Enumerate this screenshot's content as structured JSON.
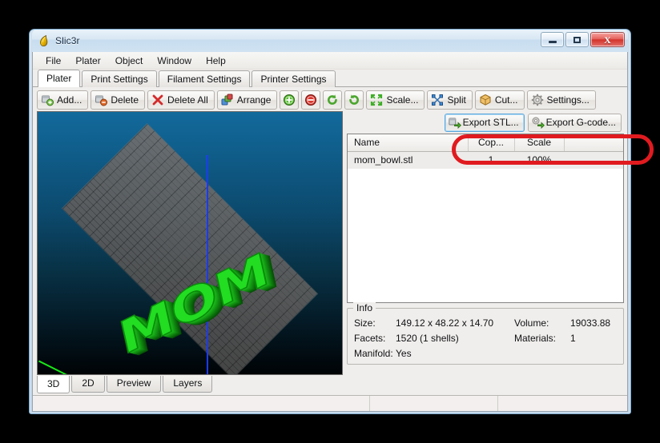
{
  "window": {
    "title": "Slic3r",
    "app_icon": "slic3r-logo-icon",
    "controls": {
      "minimize_label": "Minimize",
      "maximize_label": "Maximize",
      "close_label": "Close"
    }
  },
  "menubar": {
    "items": [
      "File",
      "Plater",
      "Object",
      "Window",
      "Help"
    ]
  },
  "tabs": [
    {
      "label": "Plater",
      "active": true
    },
    {
      "label": "Print Settings",
      "active": false
    },
    {
      "label": "Filament Settings",
      "active": false
    },
    {
      "label": "Printer Settings",
      "active": false
    }
  ],
  "toolbar": {
    "buttons": [
      {
        "label": "Add...",
        "icon": "add-object-icon",
        "icon_only": false
      },
      {
        "label": "Delete",
        "icon": "delete-object-icon",
        "icon_only": false
      },
      {
        "label": "Delete All",
        "icon": "delete-all-icon",
        "icon_only": false
      },
      {
        "label": "Arrange",
        "icon": "arrange-icon",
        "icon_only": false
      },
      {
        "label": "",
        "icon": "increase-copies-icon",
        "icon_only": true
      },
      {
        "label": "",
        "icon": "decrease-copies-icon",
        "icon_only": true
      },
      {
        "label": "",
        "icon": "rotate-ccw-icon",
        "icon_only": true
      },
      {
        "label": "",
        "icon": "rotate-cw-icon",
        "icon_only": true
      },
      {
        "label": "Scale...",
        "icon": "scale-icon",
        "icon_only": false
      },
      {
        "label": "Split",
        "icon": "split-icon",
        "icon_only": false
      },
      {
        "label": "Cut...",
        "icon": "cut-icon",
        "icon_only": false
      },
      {
        "label": "Settings...",
        "icon": "settings-gear-icon",
        "icon_only": false
      }
    ]
  },
  "export": {
    "stl_label": "Export STL...",
    "gcode_label": "Export G-code...",
    "stl_icon": "export-stl-icon",
    "gcode_icon": "export-gcode-icon",
    "highlight_color": "#e01b20"
  },
  "plater": {
    "model_text": "MOM",
    "bed_color": "#5f5f5f",
    "object_color": "#22dd22",
    "axis_x_color": "#ff1d1d",
    "axis_y_color": "#19e519",
    "axis_z_color": "#1b3bff",
    "view_tabs": [
      {
        "label": "3D",
        "active": true
      },
      {
        "label": "2D",
        "active": false
      },
      {
        "label": "Preview",
        "active": false
      },
      {
        "label": "Layers",
        "active": false
      }
    ]
  },
  "object_list": {
    "columns": [
      "Name",
      "Cop...",
      "Scale",
      ""
    ],
    "rows": [
      {
        "name": "mom_bowl.stl",
        "copies": "1",
        "scale": "100%"
      }
    ]
  },
  "info": {
    "legend": "Info",
    "size_label": "Size:",
    "size_value": "149.12 x 48.22 x 14.70",
    "volume_label": "Volume:",
    "volume_value": "19033.88",
    "facets_label": "Facets:",
    "facets_value": "1520 (1 shells)",
    "materials_label": "Materials:",
    "materials_value": "1",
    "manifold_label": "Manifold:",
    "manifold_value": "Yes"
  },
  "statusbar": {
    "cells": [
      "",
      "",
      ""
    ]
  }
}
